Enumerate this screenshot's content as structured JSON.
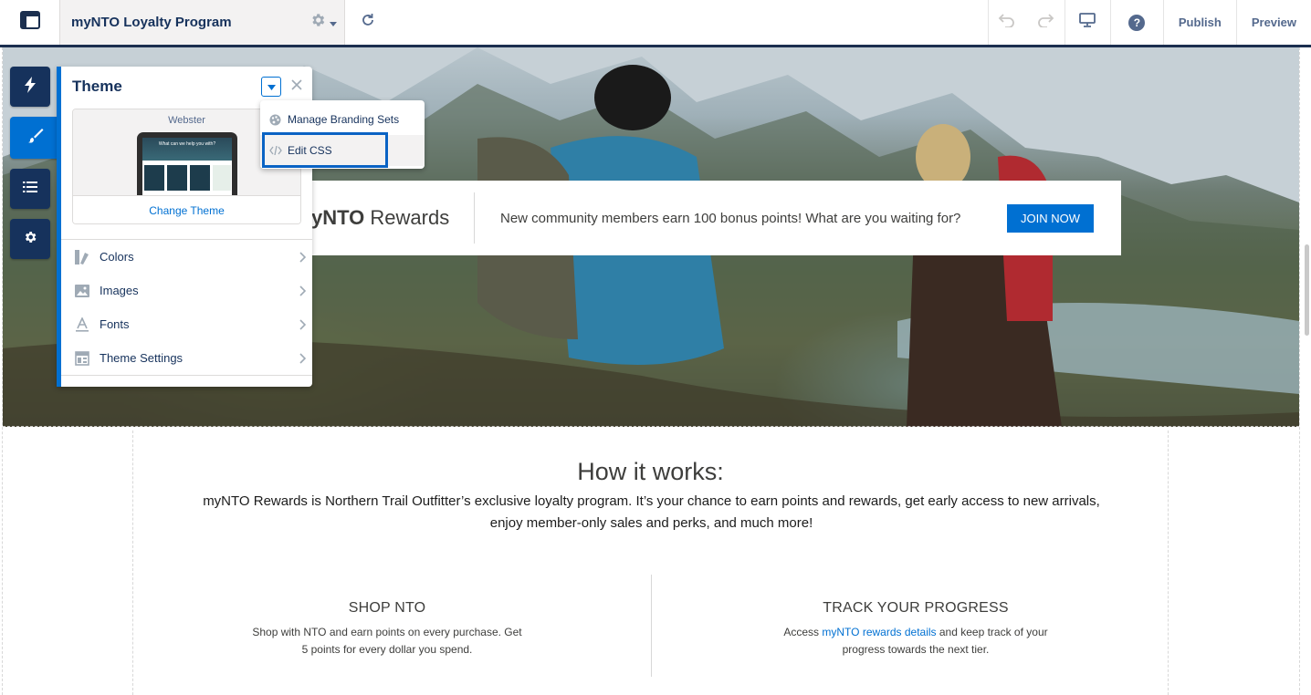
{
  "topbar": {
    "site_name": "myNTO Loyalty Program",
    "publish_label": "Publish",
    "preview_label": "Preview",
    "help_glyph": "?",
    "icons": [
      "builder-layout-icon",
      "gear-icon",
      "caret-down-icon",
      "refresh-icon",
      "undo-icon",
      "redo-icon",
      "desktop-icon",
      "help-icon"
    ]
  },
  "rail": {
    "items": [
      {
        "name": "components",
        "icon": "lightning-icon"
      },
      {
        "name": "theme",
        "icon": "brush-icon",
        "active": true
      },
      {
        "name": "page-structure",
        "icon": "list-icon"
      },
      {
        "name": "settings",
        "icon": "gear-icon"
      }
    ]
  },
  "theme_panel": {
    "title": "Theme",
    "theme_name": "Webster",
    "tablet_headline": "What can we help you with?",
    "change_theme_label": "Change Theme",
    "items": [
      {
        "label": "Colors",
        "icon": "colors-icon"
      },
      {
        "label": "Images",
        "icon": "image-icon"
      },
      {
        "label": "Fonts",
        "icon": "font-icon"
      },
      {
        "label": "Theme Settings",
        "icon": "layout-icon"
      }
    ]
  },
  "menu": {
    "items": [
      {
        "label": "Manage Branding Sets",
        "icon": "palette-icon"
      },
      {
        "label": "Edit CSS",
        "icon": "code-icon",
        "highlighted": true
      }
    ]
  },
  "page": {
    "promo": {
      "brand_bold": "yNTO",
      "brand_rest": " Rewards",
      "text": "New community members earn 100 bonus points! What are you waiting for?",
      "cta": "JOIN NOW"
    },
    "how": {
      "title": "How it works:",
      "description": "myNTO Rewards is Northern Trail Outfitter’s exclusive loyalty program. It’s your chance to earn points and rewards, get early access to new arrivals, enjoy member-only sales and perks, and much more!",
      "columns": [
        {
          "title": "SHOP NTO",
          "desc": "Shop with NTO and earn points on every purchase. Get 5 points for every dollar you spend."
        },
        {
          "title": "TRACK YOUR PROGRESS",
          "desc_pre": "Access ",
          "link": "myNTO rewards details",
          "desc_post": " and keep track of your progress towards the next tier."
        }
      ]
    }
  },
  "colors": {
    "navy": "#16325c",
    "brand_blue": "#0070d2",
    "text_gray": "#3e3e3c"
  }
}
